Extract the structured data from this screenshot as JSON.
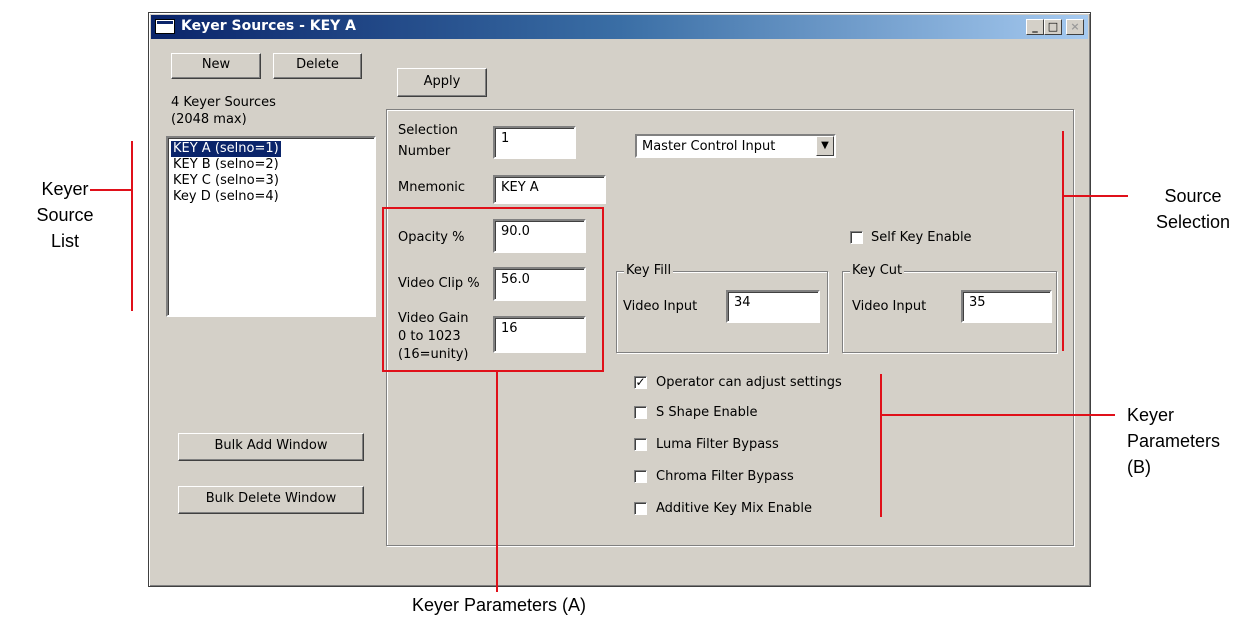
{
  "window": {
    "title": "Keyer Sources - KEY A",
    "controls": {
      "minimize": "_",
      "maximize": "□",
      "close": "×"
    }
  },
  "left": {
    "new_label": "New",
    "delete_label": "Delete",
    "count_line1": "4 Keyer Sources",
    "count_line2": "(2048 max)",
    "sources": [
      "KEY A (selno=1)",
      "KEY B (selno=2)",
      "KEY C (selno=3)",
      "Key D (selno=4)"
    ],
    "selected_index": 0,
    "bulk_add_label": "Bulk Add Window",
    "bulk_delete_label": "Bulk Delete Window"
  },
  "main": {
    "apply_label": "Apply",
    "selection_number_label_1": "Selection",
    "selection_number_label_2": "Number",
    "selection_number_value": "1",
    "source_select_value": "Master Control Input",
    "mnemonic_label": "Mnemonic",
    "mnemonic_value": "KEY A",
    "opacity_label": "Opacity %",
    "opacity_value": "90.0",
    "video_clip_label": "Video Clip %",
    "video_clip_value": "56.0",
    "video_gain_label_1": "Video Gain",
    "video_gain_label_2": "0 to 1023",
    "video_gain_label_3": "(16=unity)",
    "video_gain_value": "16",
    "self_key_label": "Self Key Enable",
    "self_key_checked": false,
    "key_fill": {
      "group_label": "Key Fill",
      "input_label": "Video Input",
      "value": "34"
    },
    "key_cut": {
      "group_label": "Key Cut",
      "input_label": "Video Input",
      "value": "35"
    },
    "checkboxes": [
      {
        "label": "Operator can adjust settings",
        "checked": true
      },
      {
        "label": "S Shape Enable",
        "checked": false
      },
      {
        "label": "Luma Filter Bypass",
        "checked": false
      },
      {
        "label": "Chroma Filter Bypass",
        "checked": false
      },
      {
        "label": "Additive Key Mix Enable",
        "checked": false
      }
    ],
    "check_mark": "✓"
  },
  "annotations": {
    "keyer_source_list": [
      "Keyer",
      "Source",
      "List"
    ],
    "source_selection": [
      "Source",
      "Selection"
    ],
    "keyer_parameters_b": [
      "Keyer",
      "Parameters",
      "(B)"
    ],
    "keyer_parameters_a": "Keyer Parameters (A)",
    "color": "#e0101a"
  }
}
